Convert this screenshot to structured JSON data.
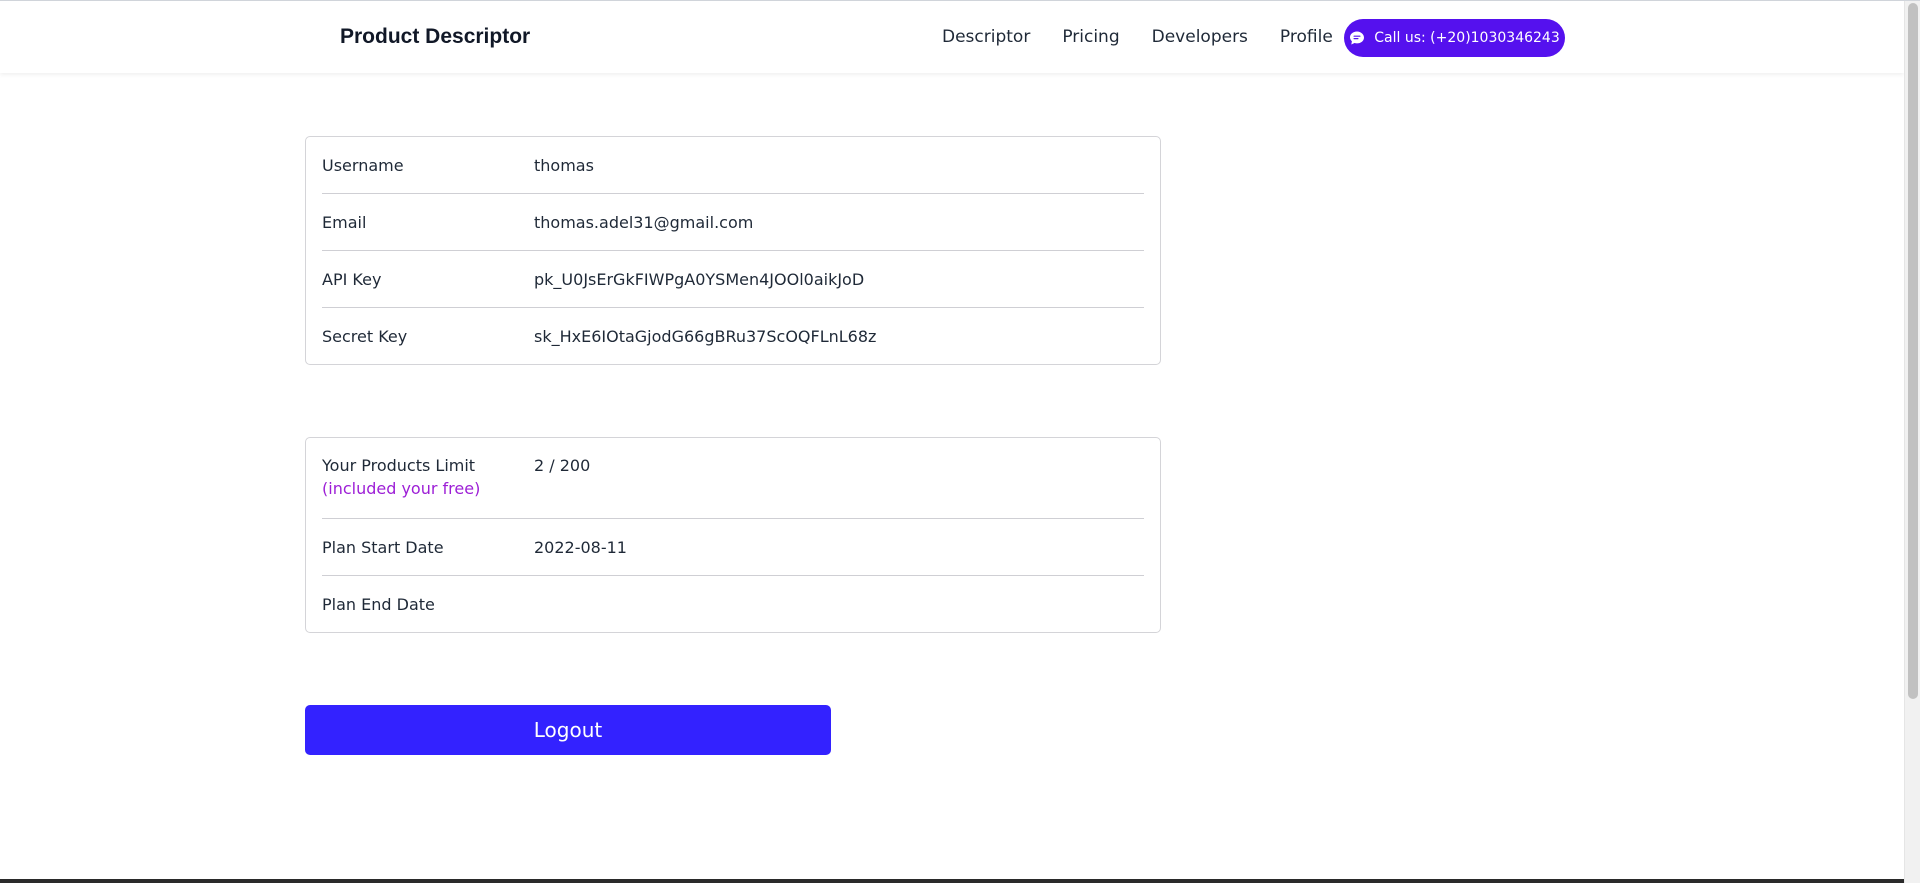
{
  "header": {
    "brand": "Product Descriptor",
    "nav": [
      "Descriptor",
      "Pricing",
      "Developers",
      "Profile"
    ],
    "call_label": "Call us: (+20)1030346243",
    "call_icon": "chat-bubble-icon"
  },
  "account": {
    "rows": [
      {
        "label": "Username",
        "value": "thomas"
      },
      {
        "label": "Email",
        "value": "thomas.adel31@gmail.com"
      },
      {
        "label": "API Key",
        "value": "pk_U0JsErGkFIWPgA0YSMen4JOOl0aikJoD"
      },
      {
        "label": "Secret Key",
        "value": "sk_HxE6IOtaGjodG66gBRu37ScOQFLnL68z"
      }
    ]
  },
  "plan": {
    "limit_label": "Your Products Limit",
    "limit_note": "(included your free)",
    "limit_value": "2 / 200",
    "start_label": "Plan Start Date",
    "start_value": "2022-08-11",
    "end_label": "Plan End Date",
    "end_value": ""
  },
  "logout_label": "Logout",
  "colors": {
    "accent": "#5511ee",
    "logout": "#3322ff",
    "note": "#9d1fd6"
  }
}
